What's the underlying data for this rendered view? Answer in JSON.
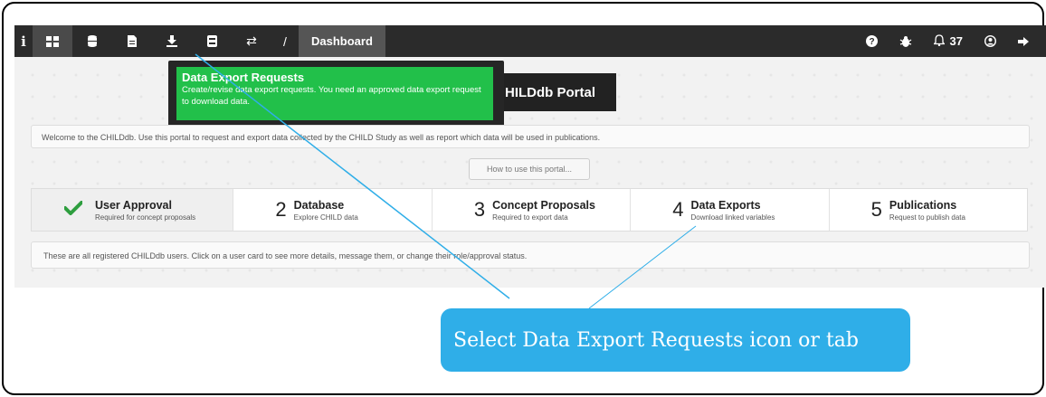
{
  "navbar": {
    "info_label": "i",
    "icons": [
      "dashboard-grid-icon",
      "database-icon",
      "document-icon",
      "download-icon",
      "book-icon",
      "transfer-icon"
    ],
    "slash": "/",
    "active_tab": "Dashboard",
    "right": {
      "help_icon": "question-icon",
      "bug_icon": "bug-icon",
      "bell_count": "37",
      "user_icon": "user-icon",
      "logout_icon": "logout-icon"
    }
  },
  "tooltip": {
    "title": "Data Export Requests",
    "text": "Create/revise data export requests. You need an approved data export request to download data."
  },
  "portal_title": "HILDdb Portal",
  "welcome_text": "Welcome to the CHILDdb. Use this portal to request and export data collected by the CHILD Study as well as report which data will be used in publications.",
  "howto_button": "How to use this portal...",
  "steps": [
    {
      "num": "",
      "title": "User Approval",
      "sub": "Required for concept proposals"
    },
    {
      "num": "2",
      "title": "Database",
      "sub": "Explore CHILD data"
    },
    {
      "num": "3",
      "title": "Concept Proposals",
      "sub": "Required to export data"
    },
    {
      "num": "4",
      "title": "Data Exports",
      "sub": "Download linked variables"
    },
    {
      "num": "5",
      "title": "Publications",
      "sub": "Request to publish data"
    }
  ],
  "users_note": "These are all registered CHILDdb users. Click on a user card to see more details, message them, or change their role/approval status.",
  "callout": "Select Data Export Requests icon or tab",
  "colors": {
    "callout": "#2faee8",
    "tooltip_green": "#22c04a",
    "navbar": "#2b2b2b",
    "check": "#2e9e3f"
  }
}
